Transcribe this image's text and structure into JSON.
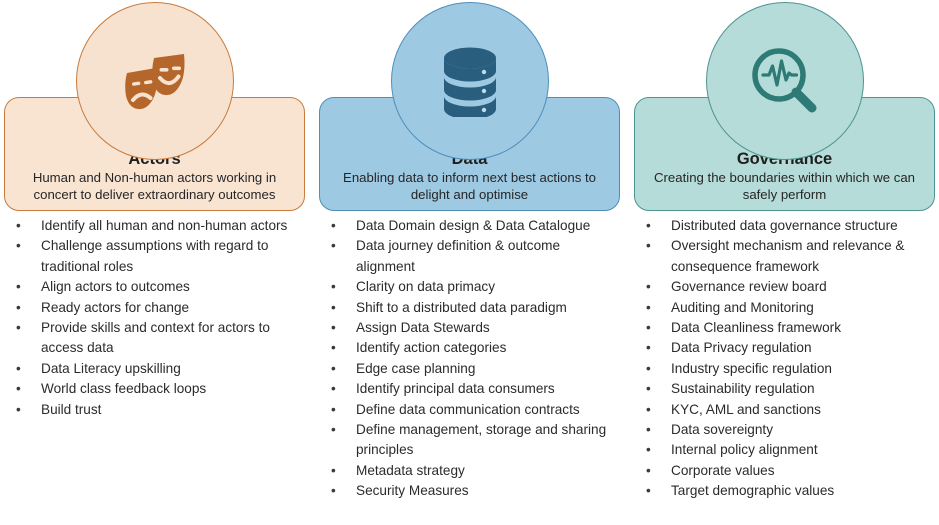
{
  "pillars": [
    {
      "id": "actors",
      "icon": "theatre-masks-icon",
      "title": "Actors",
      "subtitle": "Human and Non-human actors working in concert to deliver extraordinary outcomes",
      "accent": "#C77B3E",
      "fill": "#F9E4D2",
      "icon_color": "#B5662A",
      "bullet_char": "•",
      "bullets": [
        "Identify all human and non-human actors",
        "Challenge assumptions with regard to traditional roles",
        "Align actors to outcomes",
        "Ready actors for change",
        "Provide skills and context for actors to access data",
        "Data Literacy upskilling",
        "World class feedback loops",
        "Build trust"
      ]
    },
    {
      "id": "data",
      "icon": "database-icon",
      "title": "Data",
      "subtitle": "Enabling data to inform next best actions to delight and optimise",
      "accent": "#4E8FBA",
      "fill": "#9DC9E3",
      "icon_color": "#2A5E7E",
      "bullet_char": "•",
      "bullets": [
        "Data Domain design & Data Catalogue",
        "Data journey definition & outcome alignment",
        "Clarity on data primacy",
        "Shift to a distributed data paradigm",
        "Assign Data Stewards",
        "Identify action categories",
        "Edge case planning",
        "Identify principal data consumers",
        "Define data communication contracts",
        "Define management, storage and sharing principles",
        "Metadata strategy",
        "Security Measures"
      ]
    },
    {
      "id": "governance",
      "icon": "magnifier-pulse-icon",
      "title": "Governance",
      "subtitle": "Creating the boundaries within which we can safely perform",
      "accent": "#4E9490",
      "fill": "#B5DCD8",
      "icon_color": "#2E7A76",
      "bullet_char": "•",
      "bullets": [
        "Distributed data governance structure",
        "Oversight mechanism and relevance & consequence framework",
        "Governance review board",
        "Auditing and Monitoring",
        "Data Cleanliness framework",
        "Data Privacy regulation",
        "Industry specific regulation",
        "Sustainability regulation",
        "KYC, AML and sanctions",
        "Data sovereignty",
        "Internal policy alignment",
        "Corporate values",
        "Target demographic values"
      ]
    }
  ]
}
